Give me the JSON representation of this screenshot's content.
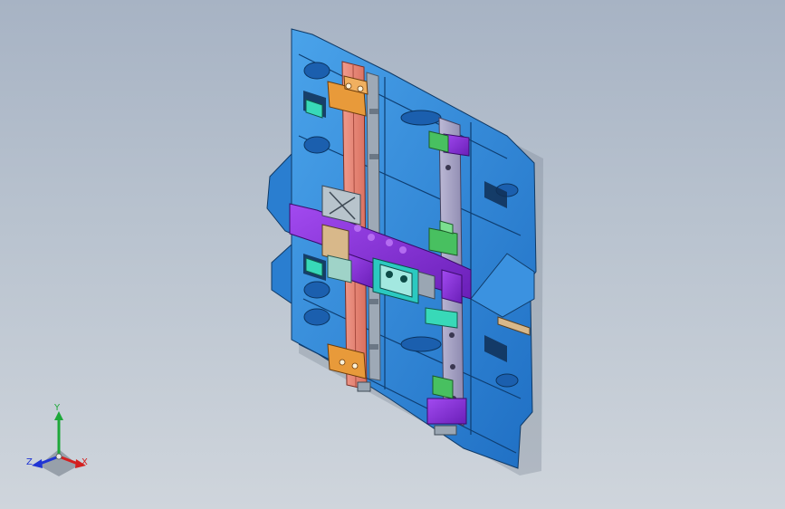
{
  "triad": {
    "y_label": "Y",
    "x_label": "X",
    "z_label": "Z",
    "y_color": "#1ea83a",
    "x_color": "#d42020",
    "z_color": "#2035d4"
  },
  "colors": {
    "background_top": "#a7b3c4",
    "background_bottom": "#cfd5dc",
    "panel_blue": "#2f86d8",
    "rail_salmon": "#e9867a",
    "block_orange": "#e89a3a",
    "clamp_purple": "#8a2fd6",
    "pad_teal": "#38d9b8",
    "pad_green": "#48c060",
    "rail_lavender": "#a7a4c4"
  }
}
